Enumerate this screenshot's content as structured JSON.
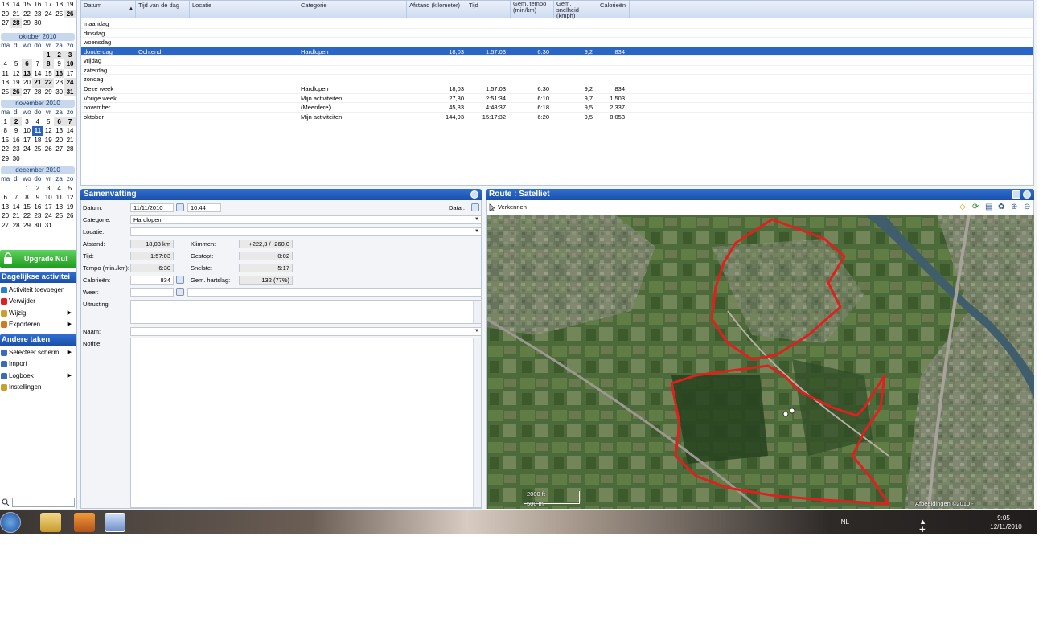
{
  "calendars": {
    "september_tail": [
      [
        "13",
        "14",
        "15",
        "16",
        "17",
        "18",
        "19"
      ],
      [
        "20",
        "21",
        "22",
        "23",
        "24",
        "25",
        "26"
      ],
      [
        "27",
        "28",
        "29",
        "30",
        "",
        "",
        ""
      ]
    ],
    "weekdays": [
      "ma",
      "di",
      "wo",
      "do",
      "vr",
      "za",
      "zo"
    ],
    "october": {
      "title": "oktober 2010",
      "weeks": [
        [
          "",
          "",
          "",
          "",
          "1",
          "2",
          "3"
        ],
        [
          "4",
          "5",
          "6",
          "7",
          "8",
          "9",
          "10"
        ],
        [
          "11",
          "12",
          "13",
          "14",
          "15",
          "16",
          "17"
        ],
        [
          "18",
          "19",
          "20",
          "21",
          "22",
          "23",
          "24"
        ],
        [
          "25",
          "26",
          "27",
          "28",
          "29",
          "30",
          "31"
        ]
      ]
    },
    "november": {
      "title": "november 2010",
      "weeks": [
        [
          "1",
          "2",
          "3",
          "4",
          "5",
          "6",
          "7"
        ],
        [
          "8",
          "9",
          "10",
          "11",
          "12",
          "13",
          "14"
        ],
        [
          "15",
          "16",
          "17",
          "18",
          "19",
          "20",
          "21"
        ],
        [
          "22",
          "23",
          "24",
          "25",
          "26",
          "27",
          "28"
        ],
        [
          "29",
          "30",
          "",
          "",
          "",
          "",
          ""
        ]
      ]
    },
    "december": {
      "title": "december 2010",
      "weeks": [
        [
          "",
          "",
          "1",
          "2",
          "3",
          "4",
          "5"
        ],
        [
          "6",
          "7",
          "8",
          "9",
          "10",
          "11",
          "12"
        ],
        [
          "13",
          "14",
          "15",
          "16",
          "17",
          "18",
          "19"
        ],
        [
          "20",
          "21",
          "22",
          "23",
          "24",
          "25",
          "26"
        ],
        [
          "27",
          "28",
          "29",
          "30",
          "31",
          "",
          ""
        ]
      ]
    }
  },
  "sidebar": {
    "upgrade_label": "Upgrade Nu!",
    "daily_header": "Dagelijkse activitei",
    "daily_items": [
      {
        "label": "Activiteit toevoegen",
        "icon": "add-icon"
      },
      {
        "label": "Verwijder",
        "icon": "delete-icon"
      },
      {
        "label": "Wijzig",
        "icon": "edit-icon"
      },
      {
        "label": "Exporteren",
        "icon": "export-icon"
      }
    ],
    "other_header": "Andere taken",
    "other_items": [
      {
        "label": "Selecteer scherm",
        "icon": "screen-icon"
      },
      {
        "label": "Import",
        "icon": "import-icon"
      },
      {
        "label": "Logboek",
        "icon": "logbook-icon"
      },
      {
        "label": "Instellingen",
        "icon": "settings-icon"
      }
    ]
  },
  "table": {
    "columns": [
      "Datum",
      "Tijd van de dag",
      "Locatie",
      "Categorie",
      "Afstand (kilometer)",
      "Tijd",
      "Gem. tempo (min/km)",
      "Gem. snelheid (kmph)",
      "Calorieën"
    ],
    "days": [
      {
        "day": "maandag"
      },
      {
        "day": "dinsdag"
      },
      {
        "day": "woensdag"
      },
      {
        "day": "donderdag",
        "time_of_day": "Ochtend",
        "category": "Hardlopen",
        "distance": "18,03",
        "time": "1:57:03",
        "pace": "6:30",
        "speed": "9,2",
        "calories": "834",
        "selected": true
      },
      {
        "day": "vrijdag"
      },
      {
        "day": "zaterdag"
      },
      {
        "day": "zondag"
      }
    ],
    "summaries": [
      {
        "period": "Deze week",
        "category": "Hardlopen",
        "distance": "18,03",
        "time": "1:57:03",
        "pace": "6:30",
        "speed": "9,2",
        "calories": "834"
      },
      {
        "period": "Vorige week",
        "category": "Mijn activiteiten",
        "distance": "27,80",
        "time": "2:51:34",
        "pace": "6:10",
        "speed": "9,7",
        "calories": "1.503"
      },
      {
        "period": "november",
        "category": "(Meerdere)",
        "distance": "45,83",
        "time": "4:48:37",
        "pace": "6:18",
        "speed": "9,5",
        "calories": "2.337"
      },
      {
        "period": "oktober",
        "category": "Mijn activiteiten",
        "distance": "144,93",
        "time": "15:17:32",
        "pace": "6:20",
        "speed": "9,5",
        "calories": "8.053"
      }
    ]
  },
  "summary": {
    "title": "Samenvatting",
    "data_label": "Data :",
    "date_label": "Datum:",
    "date_value": "11/11/2010",
    "time_value": "10:44",
    "category_label": "Categorie:",
    "category_value": "Hardlopen",
    "location_label": "Locatie:",
    "distance_label": "Afstand:",
    "distance_value": "18,03 km",
    "climb_label": "Klimmen:",
    "climb_value": "+222,3 / -260,0",
    "time_label": "Tijd:",
    "time_field": "1:57:03",
    "stopped_label": "Gestopt:",
    "stopped_value": "0:02",
    "pace_label": "Tempo (min./km):",
    "pace_value": "6:30",
    "fastest_label": "Snelste:",
    "fastest_value": "5:17",
    "calories_label": "Calorieën:",
    "calories_value": "834",
    "hr_label": "Gem. hartslag:",
    "hr_value": "132 (77%)",
    "weather_label": "Weer:",
    "equipment_label": "Uitrusting:",
    "name_label": "Naam:",
    "notes_label": "Notitie:"
  },
  "route": {
    "title": "Route : Satelliet",
    "explore_label": "Verkennen",
    "scale_ft": "2000 ft",
    "scale_m": "500 m",
    "attribution": "Afbeeldingen ©2010 - Gebruiksvoorwaarden",
    "route_color": "#e0201e"
  },
  "taskbar": {
    "lang": "NL",
    "time": "9:05",
    "date": "12/11/2010"
  }
}
